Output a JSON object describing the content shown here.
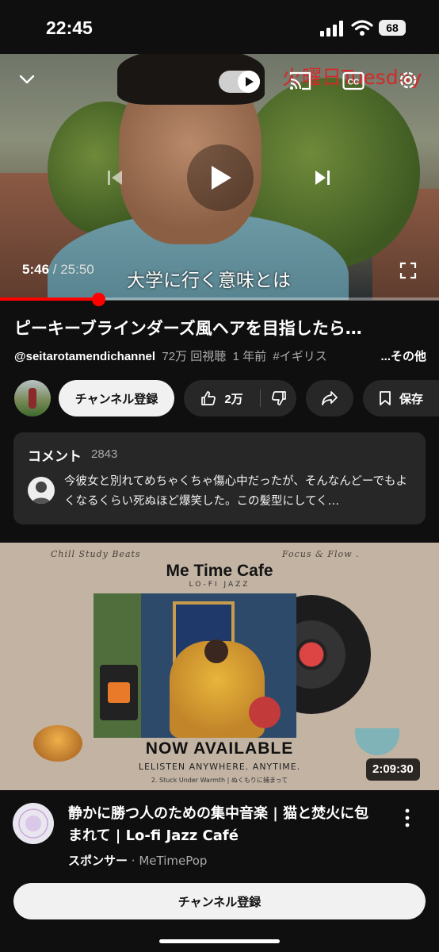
{
  "status": {
    "time": "22:45",
    "battery": "68"
  },
  "player": {
    "overlay_text": "火曜日Tuesday",
    "current_time": "5:46",
    "separator": " / ",
    "duration": "25:50",
    "subtitle": "大学に行く意味とは",
    "progress_fraction": 0.223
  },
  "video": {
    "title": "ピーキーブラインダーズ風ヘアを目指したら…",
    "channel": "@seitarotamendichannel",
    "views": "72万 回視聴",
    "age": "1 年前",
    "tag": "#イギリス",
    "more": "...その他"
  },
  "actions": {
    "subscribe": "チャンネル登録",
    "likes": "2万",
    "save": "保存"
  },
  "comments": {
    "heading": "コメント",
    "count": "2843",
    "top_comment": "今彼女と別れてめちゃくちゃ傷心中だったが、そんなんどーでもよくなるくらい死ぬほど爆笑した。この髪型にしてく…"
  },
  "ad": {
    "thumb_top_left": "Chill Study Beats",
    "thumb_top_right": "Focus & Flow .",
    "brand": "Me Time Cafe",
    "brand_sub": "LO-FI JAZZ",
    "now_available": "NOW AVAILABLE",
    "listen": "LELISTEN ANYWHERE. ANYTIME.",
    "track": "2. Stuck Under Warmth | ぬくもりに捕まって",
    "duration": "2:09:30",
    "title": "静かに勝つ人のための集中音楽 | 猫と焚火に包まれて | Lo-fi Jazz Café",
    "sponsor_label": "スポンサー",
    "dot": " · ",
    "advertiser": "MeTimePop",
    "subscribe": "チャンネル登録"
  }
}
